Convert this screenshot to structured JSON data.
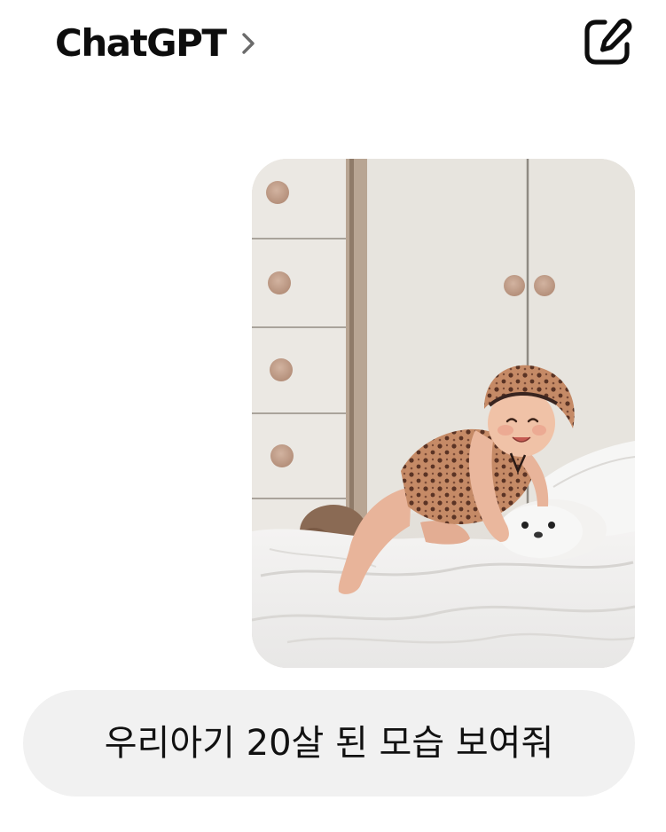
{
  "header": {
    "title": "ChatGPT",
    "title_icon": "chevron-right-icon",
    "compose_icon": "new-chat-pencil-icon"
  },
  "conversation": {
    "attachment": {
      "icon": "photo"
    },
    "user_message": {
      "text": "우리아기 20살 된 모습 보여줘"
    }
  },
  "colors": {
    "background": "#ffffff",
    "text": "#0d0d0d",
    "bubble": "#f1f1f1",
    "icon_gray": "#6b6b6b"
  }
}
